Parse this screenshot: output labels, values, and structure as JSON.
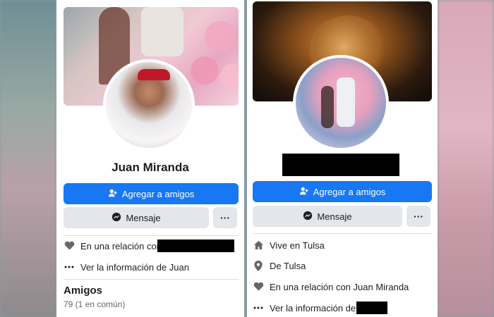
{
  "left_profile": {
    "name": "Juan Miranda",
    "add_friend": "Agregar a amigos",
    "message": "Mensaje",
    "more": "···",
    "relationship": "En una relación con",
    "see_info": "Ver la información de Juan",
    "friends_title": "Amigos",
    "friends_count": "79 (1 en común)"
  },
  "right_profile": {
    "add_friend": "Agregar a amigos",
    "message": "Mensaje",
    "more": "···",
    "lives_in": "Vive en Tulsa",
    "from": "De Tulsa",
    "relationship": "En una relación con Juan Miranda",
    "see_info": "Ver la información de"
  },
  "colors": {
    "primary": "#1877f2",
    "secondary": "#e4e6eb",
    "text": "#1c1e21",
    "muted": "#65676b"
  },
  "icons": [
    "add-friend-icon",
    "messenger-icon",
    "heart-icon",
    "home-icon",
    "location-pin-icon",
    "more-dots-icon"
  ]
}
